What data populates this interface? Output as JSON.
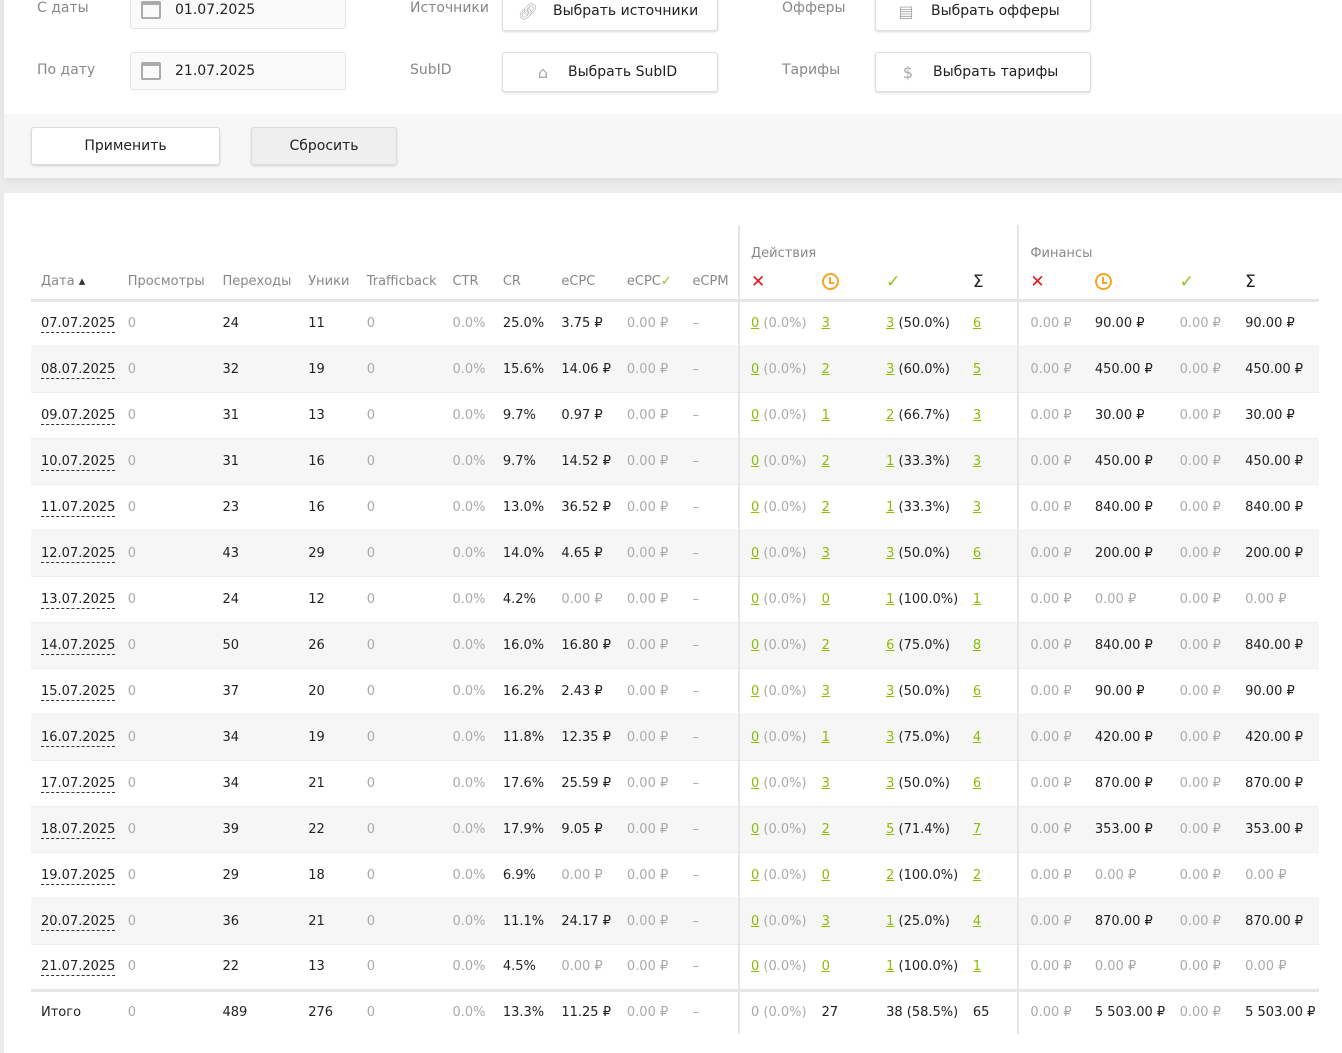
{
  "filters": {
    "date_from_label": "С даты",
    "date_from": "01.07.2025",
    "date_to_label": "По дату",
    "date_to": "21.07.2025",
    "sources_label": "Источники",
    "sources_button": "Выбрать источники",
    "subid_label": "SubID",
    "subid_button": "Выбрать SubID",
    "offers_label": "Офферы",
    "offers_button": "Выбрать офферы",
    "tariffs_label": "Тарифы",
    "tariffs_button": "Выбрать тарифы",
    "apply": "Применить",
    "reset": "Сбросить"
  },
  "table": {
    "group_actions": "Действия",
    "group_finance": "Финансы",
    "headers": [
      "Дата",
      "Просмотры",
      "Переходы",
      "Уники",
      "Trafficback",
      "CTR",
      "CR",
      "eCPC",
      "eCPC",
      "eCPM"
    ],
    "sort_icon": "▴",
    "status_icons": [
      "✕",
      "clock",
      "✓",
      "Σ"
    ],
    "rows": [
      [
        "07.07.2025",
        "0",
        "24",
        "11",
        "0",
        "0.0%",
        "25.0%",
        "3.75 ₽",
        "0.00 ₽",
        "–",
        "0",
        "(0.0%)",
        "3",
        "3",
        "(50.0%)",
        "6",
        "0.00 ₽",
        "90.00 ₽",
        "0.00 ₽",
        "90.00 ₽"
      ],
      [
        "08.07.2025",
        "0",
        "32",
        "19",
        "0",
        "0.0%",
        "15.6%",
        "14.06 ₽",
        "0.00 ₽",
        "–",
        "0",
        "(0.0%)",
        "2",
        "3",
        "(60.0%)",
        "5",
        "0.00 ₽",
        "450.00 ₽",
        "0.00 ₽",
        "450.00 ₽"
      ],
      [
        "09.07.2025",
        "0",
        "31",
        "13",
        "0",
        "0.0%",
        "9.7%",
        "0.97 ₽",
        "0.00 ₽",
        "–",
        "0",
        "(0.0%)",
        "1",
        "2",
        "(66.7%)",
        "3",
        "0.00 ₽",
        "30.00 ₽",
        "0.00 ₽",
        "30.00 ₽"
      ],
      [
        "10.07.2025",
        "0",
        "31",
        "16",
        "0",
        "0.0%",
        "9.7%",
        "14.52 ₽",
        "0.00 ₽",
        "–",
        "0",
        "(0.0%)",
        "2",
        "1",
        "(33.3%)",
        "3",
        "0.00 ₽",
        "450.00 ₽",
        "0.00 ₽",
        "450.00 ₽"
      ],
      [
        "11.07.2025",
        "0",
        "23",
        "16",
        "0",
        "0.0%",
        "13.0%",
        "36.52 ₽",
        "0.00 ₽",
        "–",
        "0",
        "(0.0%)",
        "2",
        "1",
        "(33.3%)",
        "3",
        "0.00 ₽",
        "840.00 ₽",
        "0.00 ₽",
        "840.00 ₽"
      ],
      [
        "12.07.2025",
        "0",
        "43",
        "29",
        "0",
        "0.0%",
        "14.0%",
        "4.65 ₽",
        "0.00 ₽",
        "–",
        "0",
        "(0.0%)",
        "3",
        "3",
        "(50.0%)",
        "6",
        "0.00 ₽",
        "200.00 ₽",
        "0.00 ₽",
        "200.00 ₽"
      ],
      [
        "13.07.2025",
        "0",
        "24",
        "12",
        "0",
        "0.0%",
        "4.2%",
        "0.00 ₽",
        "0.00 ₽",
        "–",
        "0",
        "(0.0%)",
        "0",
        "1",
        "(100.0%)",
        "1",
        "0.00 ₽",
        "0.00 ₽",
        "0.00 ₽",
        "0.00 ₽"
      ],
      [
        "14.07.2025",
        "0",
        "50",
        "26",
        "0",
        "0.0%",
        "16.0%",
        "16.80 ₽",
        "0.00 ₽",
        "–",
        "0",
        "(0.0%)",
        "2",
        "6",
        "(75.0%)",
        "8",
        "0.00 ₽",
        "840.00 ₽",
        "0.00 ₽",
        "840.00 ₽"
      ],
      [
        "15.07.2025",
        "0",
        "37",
        "20",
        "0",
        "0.0%",
        "16.2%",
        "2.43 ₽",
        "0.00 ₽",
        "–",
        "0",
        "(0.0%)",
        "3",
        "3",
        "(50.0%)",
        "6",
        "0.00 ₽",
        "90.00 ₽",
        "0.00 ₽",
        "90.00 ₽"
      ],
      [
        "16.07.2025",
        "0",
        "34",
        "19",
        "0",
        "0.0%",
        "11.8%",
        "12.35 ₽",
        "0.00 ₽",
        "–",
        "0",
        "(0.0%)",
        "1",
        "3",
        "(75.0%)",
        "4",
        "0.00 ₽",
        "420.00 ₽",
        "0.00 ₽",
        "420.00 ₽"
      ],
      [
        "17.07.2025",
        "0",
        "34",
        "21",
        "0",
        "0.0%",
        "17.6%",
        "25.59 ₽",
        "0.00 ₽",
        "–",
        "0",
        "(0.0%)",
        "3",
        "3",
        "(50.0%)",
        "6",
        "0.00 ₽",
        "870.00 ₽",
        "0.00 ₽",
        "870.00 ₽"
      ],
      [
        "18.07.2025",
        "0",
        "39",
        "22",
        "0",
        "0.0%",
        "17.9%",
        "9.05 ₽",
        "0.00 ₽",
        "–",
        "0",
        "(0.0%)",
        "2",
        "5",
        "(71.4%)",
        "7",
        "0.00 ₽",
        "353.00 ₽",
        "0.00 ₽",
        "353.00 ₽"
      ],
      [
        "19.07.2025",
        "0",
        "29",
        "18",
        "0",
        "0.0%",
        "6.9%",
        "0.00 ₽",
        "0.00 ₽",
        "–",
        "0",
        "(0.0%)",
        "0",
        "2",
        "(100.0%)",
        "2",
        "0.00 ₽",
        "0.00 ₽",
        "0.00 ₽",
        "0.00 ₽"
      ],
      [
        "20.07.2025",
        "0",
        "36",
        "21",
        "0",
        "0.0%",
        "11.1%",
        "24.17 ₽",
        "0.00 ₽",
        "–",
        "0",
        "(0.0%)",
        "3",
        "1",
        "(25.0%)",
        "4",
        "0.00 ₽",
        "870.00 ₽",
        "0.00 ₽",
        "870.00 ₽"
      ],
      [
        "21.07.2025",
        "0",
        "22",
        "13",
        "0",
        "0.0%",
        "4.5%",
        "0.00 ₽",
        "0.00 ₽",
        "–",
        "0",
        "(0.0%)",
        "0",
        "1",
        "(100.0%)",
        "1",
        "0.00 ₽",
        "0.00 ₽",
        "0.00 ₽",
        "0.00 ₽"
      ]
    ],
    "total": [
      "Итого",
      "0",
      "489",
      "276",
      "0",
      "0.0%",
      "13.3%",
      "11.25 ₽",
      "0.00 ₽",
      "–",
      "0",
      "(0.0%)",
      "27",
      "38",
      "(58.5%)",
      "65",
      "0.00 ₽",
      "5 503.00 ₽",
      "0.00 ₽",
      "5 503.00 ₽"
    ]
  }
}
